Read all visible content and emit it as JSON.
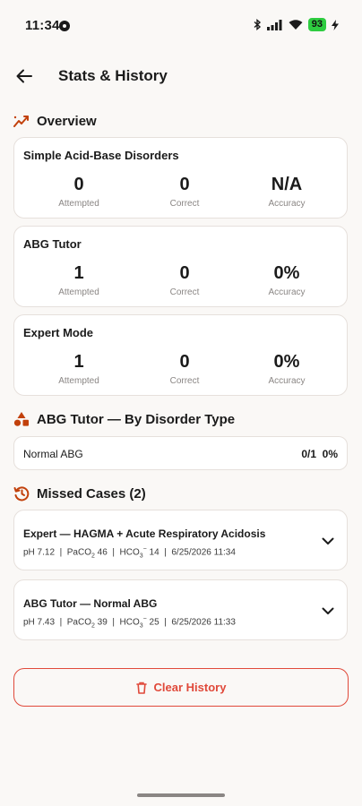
{
  "status_bar": {
    "time": "11:34",
    "battery": "93"
  },
  "header": {
    "title": "Stats & History"
  },
  "overview": {
    "heading": "Overview",
    "cards": [
      {
        "title": "Simple Acid-Base Disorders",
        "attempted": "0",
        "correct": "0",
        "accuracy": "N/A"
      },
      {
        "title": "ABG Tutor",
        "attempted": "1",
        "correct": "0",
        "accuracy": "0%"
      },
      {
        "title": "Expert Mode",
        "attempted": "1",
        "correct": "0",
        "accuracy": "0%"
      }
    ],
    "labels": {
      "attempted": "Attempted",
      "correct": "Correct",
      "accuracy": "Accuracy"
    }
  },
  "by_disorder": {
    "heading": "ABG Tutor — By Disorder Type",
    "rows": [
      {
        "name": "Normal ABG",
        "fraction": "0/1",
        "percent": "0%"
      }
    ]
  },
  "missed": {
    "heading": "Missed Cases (2)",
    "cases": [
      {
        "title": "Expert — HAGMA + Acute Respiratory Acidosis",
        "ph": "pH 7.12",
        "paco2_label": "PaCO",
        "paco2_value": " 46",
        "hco3_label": "HCO",
        "hco3_value": " 14",
        "datetime": "6/25/2026 11:34"
      },
      {
        "title": "ABG Tutor — Normal ABG",
        "ph": "pH 7.43",
        "paco2_label": "PaCO",
        "paco2_value": " 39",
        "hco3_label": "HCO",
        "hco3_value": " 25",
        "datetime": "6/25/2026 11:33"
      }
    ]
  },
  "clear_button": {
    "label": "Clear History"
  },
  "colors": {
    "accent": "#e0493a",
    "icon": "#c2410c",
    "background": "#faf8f6"
  }
}
